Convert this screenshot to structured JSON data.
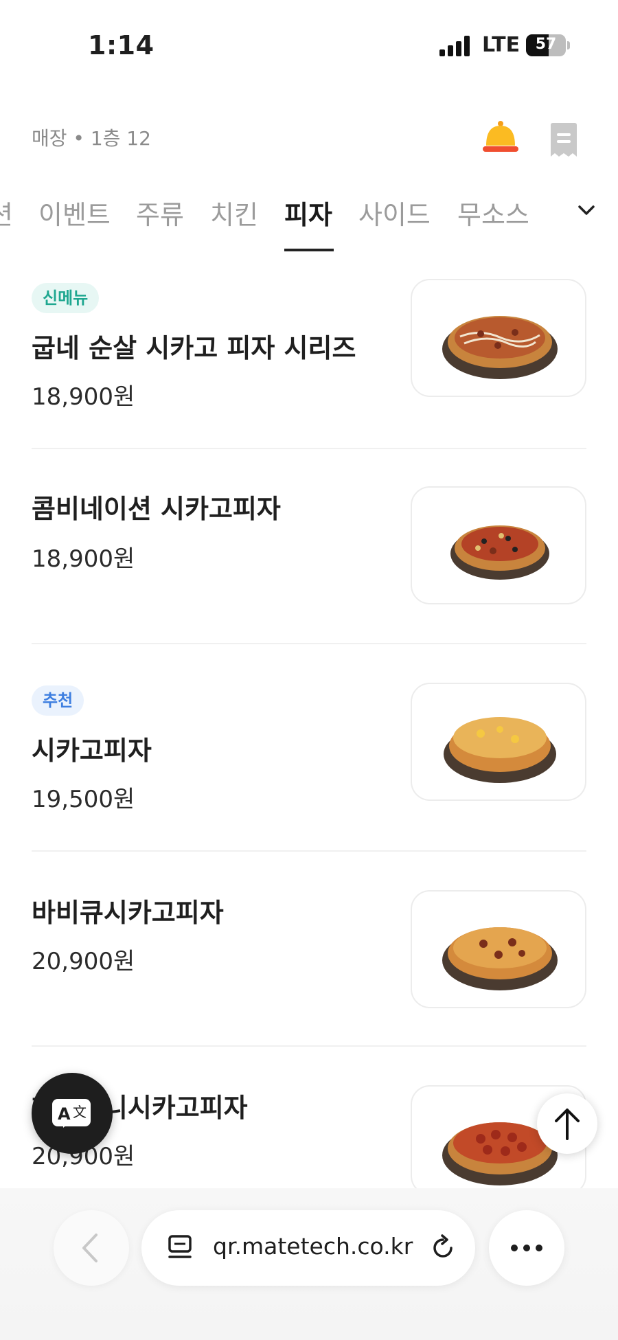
{
  "status_bar": {
    "time": "1:14",
    "network": "LTE",
    "battery_level": "57",
    "battery_fraction": 0.57
  },
  "header": {
    "store_label": "매장 • 1층 12",
    "bell_icon": "bell-icon",
    "receipt_icon": "receipt-icon"
  },
  "tabs": {
    "items": [
      "션",
      "이벤트",
      "주류",
      "치킨",
      "피자",
      "사이드",
      "무소스"
    ],
    "active": "피자",
    "expand_icon": "chevron-down-icon"
  },
  "menu": {
    "items": [
      {
        "badge": "신메뉴",
        "name": "굽네 순살 시카고 피자 시리즈",
        "price": "18,900원"
      },
      {
        "badge": "",
        "name": "콤비네이션 시카고피자",
        "price": "18,900원"
      },
      {
        "badge": "추천",
        "name": "시카고피자",
        "price": "19,500원"
      },
      {
        "badge": "",
        "name": "바비큐시카고피자",
        "price": "20,900원"
      },
      {
        "badge": "",
        "name": "페퍼로니시카고피자",
        "price": "20,900원"
      }
    ]
  },
  "floating": {
    "translate_icon": "translate-icon",
    "scroll_top_icon": "arrow-up-icon"
  },
  "browser": {
    "url": "qr.matetech.co.kr",
    "back_icon": "chevron-left-icon",
    "tabs_icon": "page-icon",
    "reload_icon": "reload-icon",
    "more_icon": "more-icon"
  },
  "colors": {
    "accent_text": "#1a1a1a",
    "badge_new": "#1fa790",
    "badge_recommend": "#3e7fe0",
    "bell": "#f7a51b"
  }
}
